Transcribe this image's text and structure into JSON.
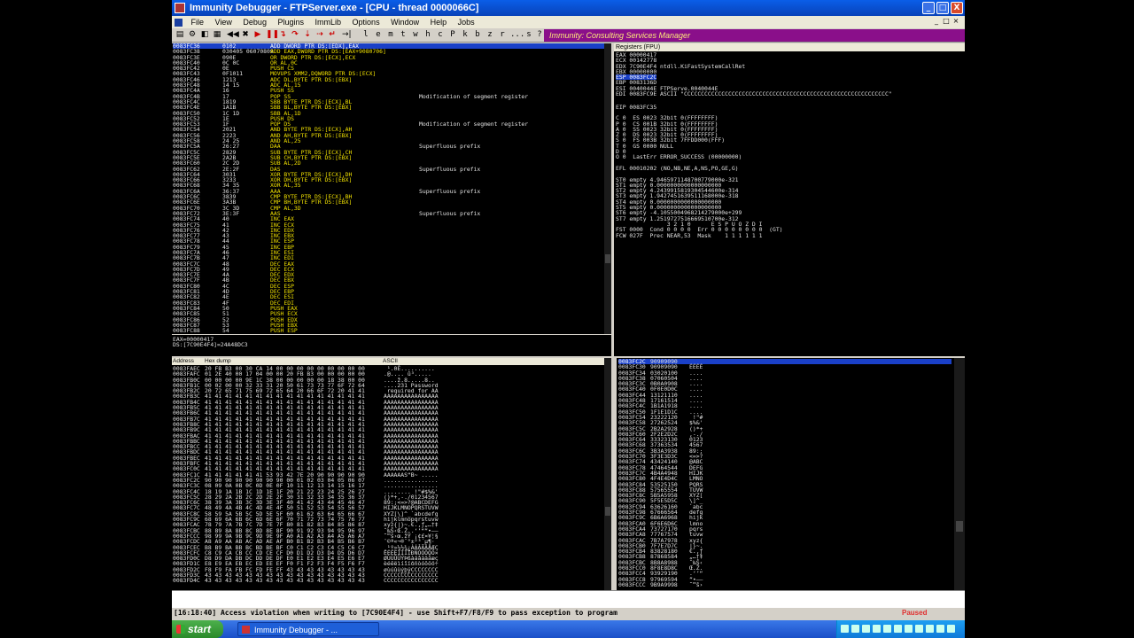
{
  "window": {
    "title": "Immunity Debugger - FTPServer.exe - [CPU - thread 0000066C]",
    "controls": {
      "minimize": "_",
      "maximize": "□",
      "close": "X"
    }
  },
  "menu": [
    "File",
    "View",
    "Debug",
    "Plugins",
    "ImmLib",
    "Options",
    "Window",
    "Help",
    "Jobs"
  ],
  "mdi_controls": [
    "_",
    "□",
    "×"
  ],
  "toolbar": {
    "letters": [
      "l",
      "e",
      "m",
      "t",
      "w",
      "h",
      "c",
      "P",
      "k",
      "b",
      "z",
      "r",
      "...",
      "s",
      "?"
    ],
    "banner": "Immunity: Consulting Services Manager"
  },
  "registers_header": "Registers (FPU)",
  "dump_header": {
    "address": "Address",
    "hex": "Hex dump",
    "ascii": "ASCII"
  },
  "cpu_lines": [
    [
      "0083FC36",
      "0102",
      "ADD DWORD PTR DS:[EDX],EAX",
      ""
    ],
    [
      "0083FC38",
      "030405 06070809",
      "ADD EAX,DWORD PTR DS:[EAX+9080706]",
      ""
    ],
    [
      "0083FC3E",
      "090E",
      "OR DWORD PTR DS:[ECX],ECX",
      ""
    ],
    [
      "0083FC40",
      "0C 0C",
      "OR AL,0C",
      ""
    ],
    [
      "0083FC42",
      "0E",
      "PUSH CS",
      ""
    ],
    [
      "0083FC43",
      "0F1011",
      "MOVUPS XMM2,DQWORD PTR DS:[ECX]",
      ""
    ],
    [
      "0083FC46",
      "1213",
      "ADC DL,BYTE PTR DS:[EBX]",
      ""
    ],
    [
      "0083FC48",
      "14 15",
      "ADC AL,15",
      ""
    ],
    [
      "0083FC4A",
      "16",
      "PUSH SS",
      ""
    ],
    [
      "0083FC4B",
      "17",
      "POP SS",
      "Modification of segment register"
    ],
    [
      "0083FC4C",
      "1819",
      "SBB BYTE PTR DS:[ECX],BL",
      ""
    ],
    [
      "0083FC4E",
      "1A1B",
      "SBB BL,BYTE PTR DS:[EBX]",
      ""
    ],
    [
      "0083FC50",
      "1C 1D",
      "SBB AL,1D",
      ""
    ],
    [
      "0083FC52",
      "1E",
      "PUSH DS",
      ""
    ],
    [
      "0083FC53",
      "1F",
      "POP DS",
      "Modification of segment register"
    ],
    [
      "0083FC54",
      "2021",
      "AND BYTE PTR DS:[ECX],AH",
      ""
    ],
    [
      "0083FC56",
      "2223",
      "AND AH,BYTE PTR DS:[EBX]",
      ""
    ],
    [
      "0083FC58",
      "24 25",
      "AND AL,25",
      ""
    ],
    [
      "0083FC5A",
      "26:27",
      "DAA",
      "Superfluous prefix"
    ],
    [
      "0083FC5C",
      "2829",
      "SUB BYTE PTR DS:[ECX],CH",
      ""
    ],
    [
      "0083FC5E",
      "2A2B",
      "SUB CH,BYTE PTR DS:[EBX]",
      ""
    ],
    [
      "0083FC60",
      "2C 2D",
      "SUB AL,2D",
      ""
    ],
    [
      "0083FC62",
      "2E:2F",
      "DAS",
      "Superfluous prefix"
    ],
    [
      "0083FC64",
      "3031",
      "XOR BYTE PTR DS:[ECX],DH",
      ""
    ],
    [
      "0083FC66",
      "3233",
      "XOR DH,BYTE PTR DS:[EBX]",
      ""
    ],
    [
      "0083FC68",
      "34 35",
      "XOR AL,35",
      ""
    ],
    [
      "0083FC6A",
      "36:37",
      "AAA",
      "Superfluous prefix"
    ],
    [
      "0083FC6C",
      "3839",
      "CMP BYTE PTR DS:[ECX],BH",
      ""
    ],
    [
      "0083FC6E",
      "3A3B",
      "CMP BH,BYTE PTR DS:[EBX]",
      ""
    ],
    [
      "0083FC70",
      "3C 3D",
      "CMP AL,3D",
      ""
    ],
    [
      "0083FC72",
      "3E:3F",
      "AAS",
      "Superfluous prefix"
    ],
    [
      "0083FC74",
      "40",
      "INC EAX",
      ""
    ],
    [
      "0083FC75",
      "41",
      "INC ECX",
      ""
    ],
    [
      "0083FC76",
      "42",
      "INC EDX",
      ""
    ],
    [
      "0083FC77",
      "43",
      "INC EBX",
      ""
    ],
    [
      "0083FC78",
      "44",
      "INC ESP",
      ""
    ],
    [
      "0083FC79",
      "45",
      "INC EBP",
      ""
    ],
    [
      "0083FC7A",
      "46",
      "INC ESI",
      ""
    ],
    [
      "0083FC7B",
      "47",
      "INC EDI",
      ""
    ],
    [
      "0083FC7C",
      "48",
      "DEC EAX",
      ""
    ],
    [
      "0083FC7D",
      "49",
      "DEC ECX",
      ""
    ],
    [
      "0083FC7E",
      "4A",
      "DEC EDX",
      ""
    ],
    [
      "0083FC7F",
      "4B",
      "DEC EBX",
      ""
    ],
    [
      "0083FC80",
      "4C",
      "DEC ESP",
      ""
    ],
    [
      "0083FC81",
      "4D",
      "DEC EBP",
      ""
    ],
    [
      "0083FC82",
      "4E",
      "DEC ESI",
      ""
    ],
    [
      "0083FC83",
      "4F",
      "DEC EDI",
      ""
    ],
    [
      "0083FC84",
      "50",
      "PUSH EAX",
      ""
    ],
    [
      "0083FC85",
      "51",
      "PUSH ECX",
      ""
    ],
    [
      "0083FC86",
      "52",
      "PUSH EDX",
      ""
    ],
    [
      "0083FC87",
      "53",
      "PUSH EBX",
      ""
    ],
    [
      "0083FC88",
      "54",
      "PUSH ESP",
      ""
    ]
  ],
  "info_lines": [
    "EAX=00000417",
    "DS:[7C90E4F4]=24A48DC3"
  ],
  "registers": [
    "EAX 00000417",
    "ECX 00142778",
    "EDX 7C90E4F4 ntdll.KiFastSystemCallRet",
    "EBX 00000000",
    "ESP 0083FC2C",
    "EBP 0083136D",
    "ESI 0040044E FTPServe.0040044E",
    "EDI 0083FC9E ASCII \"CCCCCCCCCCCCCCCCCCCCCCCCCCCCCCCCCCCCCCCCCCCCCCCCCCCCCCCCCCCC\"",
    "",
    "EIP 0083FC35",
    "",
    "C 0  ES 0023 32bit 0(FFFFFFFF)",
    "P 0  CS 001B 32bit 0(FFFFFFFF)",
    "A 0  SS 0023 32bit 0(FFFFFFFF)",
    "Z 0  DS 0023 32bit 0(FFFFFFFF)",
    "S 0  FS 003B 32bit 7FFDD000(FFF)",
    "T 0  GS 0000 NULL",
    "D 0",
    "O 0  LastErr ERROR_SUCCESS (00000000)",
    "",
    "EFL 00010202 (NO,NB,NE,A,NS,PO,GE,G)",
    "",
    "ST0 empty 4.9465971148700779000e-321",
    "ST1 empty 0.0000000000000000000",
    "ST2 empty 4.2439915819304544600e-314",
    "ST3 empty 1.9427451639511168000e-318",
    "ST4 empty 0.0000000000000000000",
    "ST5 empty 0.0000000000000000000",
    "ST6 empty -4.1055004968214279000e+299",
    "ST7 empty 1.2519727516669510700e-312",
    "               3 2 1 0      E S P U O Z D I",
    "FST 0000  Cond 0 0 0 0  Err 0 0 0 0 0 0 0 0  (GT)",
    "FCW 027F  Prec NEAR,53  Mask    1 1 1 1 1 1"
  ],
  "dump_lines": [
    [
      "0083FAEC",
      "20 FB B3 00 30 CA 14 00 00 00 00 00 00 00 00 00",
      " ¹.0Ê.........."
    ],
    [
      "0083FAFC",
      "01 2E 40 00 17 04 00 00 20 FB B3 00 00 00 00 00",
      ".@.... û³....."
    ],
    [
      "0083FB0C",
      "00 00 00 00 9E 1C 38 00 00 00 00 00 18 38 00 00",
      "....ž.8.....8.."
    ],
    [
      "0083FB1C",
      "00 02 00 00 32 33 31 20 50 61 73 73 77 6F 72 64",
      "....231 Password"
    ],
    [
      "0083FB2C",
      "20 72 65 71 75 69 72 65 64 20 66 6F 72 20 41 41",
      " required for AA"
    ],
    [
      "0083FB3C",
      "41 41 41 41 41 41 41 41 41 41 41 41 41 41 41 41",
      "AAAAAAAAAAAAAAAA"
    ],
    [
      "0083FB4C",
      "41 41 41 41 41 41 41 41 41 41 41 41 41 41 41 41",
      "AAAAAAAAAAAAAAAA"
    ],
    [
      "0083FB5C",
      "41 41 41 41 41 41 41 41 41 41 41 41 41 41 41 41",
      "AAAAAAAAAAAAAAAA"
    ],
    [
      "0083FB6C",
      "41 41 41 41 41 41 41 41 41 41 41 41 41 41 41 41",
      "AAAAAAAAAAAAAAAA"
    ],
    [
      "0083FB7C",
      "41 41 41 41 41 41 41 41 41 41 41 41 41 41 41 41",
      "AAAAAAAAAAAAAAAA"
    ],
    [
      "0083FB8C",
      "41 41 41 41 41 41 41 41 41 41 41 41 41 41 41 41",
      "AAAAAAAAAAAAAAAA"
    ],
    [
      "0083FB9C",
      "41 41 41 41 41 41 41 41 41 41 41 41 41 41 41 41",
      "AAAAAAAAAAAAAAAA"
    ],
    [
      "0083FBAC",
      "41 41 41 41 41 41 41 41 41 41 41 41 41 41 41 41",
      "AAAAAAAAAAAAAAAA"
    ],
    [
      "0083FBBC",
      "41 41 41 41 41 41 41 41 41 41 41 41 41 41 41 41",
      "AAAAAAAAAAAAAAAA"
    ],
    [
      "0083FBCC",
      "41 41 41 41 41 41 41 41 41 41 41 41 41 41 41 41",
      "AAAAAAAAAAAAAAAA"
    ],
    [
      "0083FBDC",
      "41 41 41 41 41 41 41 41 41 41 41 41 41 41 41 41",
      "AAAAAAAAAAAAAAAA"
    ],
    [
      "0083FBEC",
      "41 41 41 41 41 41 41 41 41 41 41 41 41 41 41 41",
      "AAAAAAAAAAAAAAAA"
    ],
    [
      "0083FBFC",
      "41 41 41 41 41 41 41 41 41 41 41 41 41 41 41 41",
      "AAAAAAAAAAAAAAAA"
    ],
    [
      "0083FC0C",
      "41 41 41 41 41 41 41 41 41 41 41 41 41 41 41 41",
      "AAAAAAAAAAAAAAAA"
    ],
    [
      "0083FC1C",
      "41 41 41 41 41 41 53 93 42 7E 20 90 90 90 90 90",
      "AAAAAAS“B~ ....."
    ],
    [
      "0083FC2C",
      "90 90 90 90 90 90 90 90 00 01 02 03 04 05 06 07",
      "................"
    ],
    [
      "0083FC3C",
      "08 09 0A 0B 0C 0D 0E 0F 10 11 12 13 14 15 16 17",
      "................"
    ],
    [
      "0083FC4C",
      "18 19 1A 1B 1C 1D 1E 1F 20 21 22 23 24 25 26 27",
      "........ !\"#$%&'"
    ],
    [
      "0083FC5C",
      "28 29 2A 2B 2C 2D 2E 2F 30 31 32 33 34 35 36 37",
      "()*+,-./01234567"
    ],
    [
      "0083FC6C",
      "38 39 3A 3B 3C 3D 3E 3F 40 41 42 43 44 45 46 47",
      "89:;<=>?@ABCDEFG"
    ],
    [
      "0083FC7C",
      "48 49 4A 4B 4C 4D 4E 4F 50 51 52 53 54 55 56 57",
      "HIJKLMNOPQRSTUVW"
    ],
    [
      "0083FC8C",
      "58 59 5A 5B 5C 5D 5E 5F 60 61 62 63 64 65 66 67",
      "XYZ[\\]^_`abcdefg"
    ],
    [
      "0083FC9C",
      "68 69 6A 6B 6C 6D 6E 6F 70 71 72 73 74 75 76 77",
      "hijklmnopqrstuvw"
    ],
    [
      "0083FCAC",
      "78 79 7A 7B 7C 7D 7E 7F 80 81 82 83 84 85 86 87",
      "xyz{|}~.€.‚ƒ„…†‡"
    ],
    [
      "0083FCBC",
      "88 89 8A 8B 8C 8D 8E 8F 90 91 92 93 94 95 96 97",
      "ˆ‰Š‹Œ.Ž..‘’“”•–—"
    ],
    [
      "0083FCCC",
      "98 99 9A 9B 9C 9D 9E 9F A0 A1 A2 A3 A4 A5 A6 A7",
      "˜™š›œ.žŸ ¡¢£¤¥¦§"
    ],
    [
      "0083FCDC",
      "A8 A9 AA AB AC AD AE AF B0 B1 B2 B3 B4 B5 B6 B7",
      "¨©ª«¬­®¯°±²³´µ¶·"
    ],
    [
      "0083FCEC",
      "B8 B9 BA BB BC BD BE BF C0 C1 C2 C3 C4 C5 C6 C7",
      "¸¹º»¼½¾¿ÀÁÂÃÄÅÆÇ"
    ],
    [
      "0083FCFC",
      "C8 C9 CA CB CC CD CE CF D0 D1 D2 D3 D4 D5 D6 D7",
      "ÈÉÊËÌÍÎÏÐÑÒÓÔÕÖ×"
    ],
    [
      "0083FD0C",
      "D8 D9 DA DB DC DD DE DF E0 E1 E2 E3 E4 E5 E6 E7",
      "ØÙÚÛÜÝÞßàáâãäåæç"
    ],
    [
      "0083FD1C",
      "E8 E9 EA EB EC ED EE EF F0 F1 F2 F3 F4 F5 F6 F7",
      "èéêëìíîïðñòóôõö÷"
    ],
    [
      "0083FD2C",
      "F8 F9 FA FB FC FD FE FF 43 43 43 43 43 43 43 43",
      "øùúûüýþÿCCCCCCCC"
    ],
    [
      "0083FD3C",
      "43 43 43 43 43 43 43 43 43 43 43 43 43 43 43 43",
      "CCCCCCCCCCCCCCCC"
    ],
    [
      "0083FD4C",
      "43 43 43 43 43 43 43 43 43 43 43 43 43 43 43 43",
      "CCCCCCCCCCCCCCCC"
    ]
  ],
  "stack_lines": [
    [
      "0083FC2C",
      "90909090",
      ""
    ],
    [
      "0083FC30",
      "90909090",
      "ÉÉÉÉ"
    ],
    [
      "0083FC34",
      "03020100",
      "...."
    ],
    [
      "0083FC38",
      "07060504",
      "...."
    ],
    [
      "0083FC3C",
      "0B0A0908",
      "...."
    ],
    [
      "0083FC40",
      "0F0E0D0C",
      "...."
    ],
    [
      "0083FC44",
      "13121110",
      "...."
    ],
    [
      "0083FC48",
      "17161514",
      "...."
    ],
    [
      "0083FC4C",
      "1B1A1918",
      "...."
    ],
    [
      "0083FC50",
      "1F1E1D1C",
      "...."
    ],
    [
      "0083FC54",
      "23222120",
      " !\"#"
    ],
    [
      "0083FC58",
      "27262524",
      "$%&'"
    ],
    [
      "0083FC5C",
      "2B2A2928",
      "()*+"
    ],
    [
      "0083FC60",
      "2F2E2D2C",
      ",-./"
    ],
    [
      "0083FC64",
      "33323130",
      "0123"
    ],
    [
      "0083FC68",
      "37363534",
      "4567"
    ],
    [
      "0083FC6C",
      "3B3A3938",
      "89:;"
    ],
    [
      "0083FC70",
      "3F3E3D3C",
      "<=>?"
    ],
    [
      "0083FC74",
      "43424140",
      "@ABC"
    ],
    [
      "0083FC78",
      "47464544",
      "DEFG"
    ],
    [
      "0083FC7C",
      "4B4A4948",
      "HIJK"
    ],
    [
      "0083FC80",
      "4F4E4D4C",
      "LMNO"
    ],
    [
      "0083FC84",
      "53525150",
      "PQRS"
    ],
    [
      "0083FC88",
      "57565554",
      "TUVW"
    ],
    [
      "0083FC8C",
      "5B5A5958",
      "XYZ["
    ],
    [
      "0083FC90",
      "5F5E5D5C",
      "\\]^_"
    ],
    [
      "0083FC94",
      "63626160",
      "`abc"
    ],
    [
      "0083FC98",
      "67666564",
      "defg"
    ],
    [
      "0083FC9C",
      "6B6A6968",
      "hijk"
    ],
    [
      "0083FCA0",
      "6F6E6D6C",
      "lmno"
    ],
    [
      "0083FCA4",
      "73727170",
      "pqrs"
    ],
    [
      "0083FCA8",
      "77767574",
      "tuvw"
    ],
    [
      "0083FCAC",
      "7B7A7978",
      "xyz{"
    ],
    [
      "0083FCB0",
      "7F7E7D7C",
      "|}~."
    ],
    [
      "0083FCB4",
      "83828180",
      "€.‚ƒ"
    ],
    [
      "0083FCB8",
      "87868584",
      "„…†‡"
    ],
    [
      "0083FCBC",
      "8B8A8988",
      "ˆ‰Š‹"
    ],
    [
      "0083FCC0",
      "8F8E8D8C",
      "Œ.Ž."
    ],
    [
      "0083FCC4",
      "93929190",
      ".‘’“"
    ],
    [
      "0083FCC8",
      "97969594",
      "”•–—"
    ],
    [
      "0083FCCC",
      "9B9A9998",
      "˜™š›"
    ]
  ],
  "status": {
    "message": "[16:18:40] Access violation when writing to [7C90E4F4] - use Shift+F7/F8/F9 to pass exception to program",
    "state": "Paused"
  },
  "taskbar": {
    "start_label": "start",
    "task_label": "Immunity Debugger - ..."
  },
  "colors": {
    "banner_bg": "#8a0f8a",
    "banner_text": "#ffe97a",
    "selection": "#1a40c8",
    "mnemonic": "#f0e000",
    "paused": "#e03030"
  }
}
